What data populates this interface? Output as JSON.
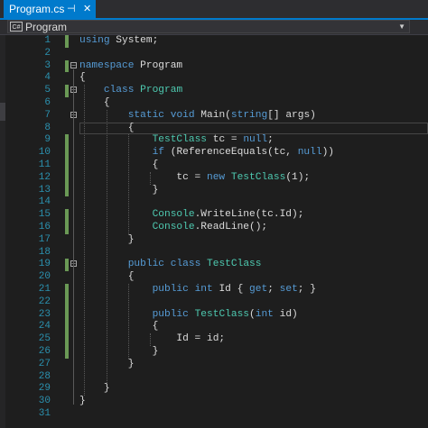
{
  "tab": {
    "title": "Program.cs",
    "pin_glyph": "⊣",
    "close_glyph": "✕"
  },
  "navbar": {
    "icon_text": "C#",
    "label": "Program"
  },
  "code_lines": [
    {
      "n": "1",
      "parts": [
        {
          "t": "using",
          "c": "kw"
        },
        {
          "t": " System;"
        }
      ]
    },
    {
      "n": "2",
      "parts": []
    },
    {
      "n": "3",
      "parts": [
        {
          "t": "namespace",
          "c": "kw"
        },
        {
          "t": " Program"
        }
      ]
    },
    {
      "n": "4",
      "parts": [
        {
          "t": "{"
        }
      ]
    },
    {
      "n": "5",
      "parts": [
        {
          "t": "    "
        },
        {
          "t": "class",
          "c": "kw"
        },
        {
          "t": " "
        },
        {
          "t": "Program",
          "c": "ty"
        }
      ]
    },
    {
      "n": "6",
      "parts": [
        {
          "t": "    {"
        }
      ]
    },
    {
      "n": "7",
      "parts": [
        {
          "t": "        "
        },
        {
          "t": "static",
          "c": "kw"
        },
        {
          "t": " "
        },
        {
          "t": "void",
          "c": "kw"
        },
        {
          "t": " Main("
        },
        {
          "t": "string",
          "c": "kw"
        },
        {
          "t": "[] args)"
        }
      ]
    },
    {
      "n": "8",
      "parts": [
        {
          "t": "        {"
        }
      ]
    },
    {
      "n": "9",
      "parts": [
        {
          "t": "            "
        },
        {
          "t": "TestClass",
          "c": "ty"
        },
        {
          "t": " tc = "
        },
        {
          "t": "null",
          "c": "kw"
        },
        {
          "t": ";"
        }
      ]
    },
    {
      "n": "10",
      "parts": [
        {
          "t": "            "
        },
        {
          "t": "if",
          "c": "kw"
        },
        {
          "t": " (ReferenceEquals(tc, "
        },
        {
          "t": "null",
          "c": "kw"
        },
        {
          "t": "))"
        }
      ]
    },
    {
      "n": "11",
      "parts": [
        {
          "t": "            {"
        }
      ]
    },
    {
      "n": "12",
      "parts": [
        {
          "t": "                tc = "
        },
        {
          "t": "new",
          "c": "kw"
        },
        {
          "t": " "
        },
        {
          "t": "TestClass",
          "c": "ty"
        },
        {
          "t": "(1);"
        }
      ]
    },
    {
      "n": "13",
      "parts": [
        {
          "t": "            }"
        }
      ]
    },
    {
      "n": "14",
      "parts": []
    },
    {
      "n": "15",
      "parts": [
        {
          "t": "            "
        },
        {
          "t": "Console",
          "c": "ty"
        },
        {
          "t": ".WriteLine(tc.Id);"
        }
      ]
    },
    {
      "n": "16",
      "parts": [
        {
          "t": "            "
        },
        {
          "t": "Console",
          "c": "ty"
        },
        {
          "t": ".ReadLine();"
        }
      ]
    },
    {
      "n": "17",
      "parts": [
        {
          "t": "        }"
        }
      ]
    },
    {
      "n": "18",
      "parts": []
    },
    {
      "n": "19",
      "parts": [
        {
          "t": "        "
        },
        {
          "t": "public",
          "c": "kw"
        },
        {
          "t": " "
        },
        {
          "t": "class",
          "c": "kw"
        },
        {
          "t": " "
        },
        {
          "t": "TestClass",
          "c": "ty"
        }
      ]
    },
    {
      "n": "20",
      "parts": [
        {
          "t": "        {"
        }
      ]
    },
    {
      "n": "21",
      "parts": [
        {
          "t": "            "
        },
        {
          "t": "public",
          "c": "kw"
        },
        {
          "t": " "
        },
        {
          "t": "int",
          "c": "kw"
        },
        {
          "t": " Id { "
        },
        {
          "t": "get",
          "c": "kw"
        },
        {
          "t": "; "
        },
        {
          "t": "set",
          "c": "kw"
        },
        {
          "t": "; }"
        }
      ]
    },
    {
      "n": "22",
      "parts": []
    },
    {
      "n": "23",
      "parts": [
        {
          "t": "            "
        },
        {
          "t": "public",
          "c": "kw"
        },
        {
          "t": " "
        },
        {
          "t": "TestClass",
          "c": "ty"
        },
        {
          "t": "("
        },
        {
          "t": "int",
          "c": "kw"
        },
        {
          "t": " id)"
        }
      ]
    },
    {
      "n": "24",
      "parts": [
        {
          "t": "            {"
        }
      ]
    },
    {
      "n": "25",
      "parts": [
        {
          "t": "                Id = id;"
        }
      ]
    },
    {
      "n": "26",
      "parts": [
        {
          "t": "            }"
        }
      ]
    },
    {
      "n": "27",
      "parts": [
        {
          "t": "        }"
        }
      ]
    },
    {
      "n": "28",
      "parts": []
    },
    {
      "n": "29",
      "parts": [
        {
          "t": "    }"
        }
      ]
    },
    {
      "n": "30",
      "parts": [
        {
          "t": "}"
        }
      ]
    },
    {
      "n": "31",
      "parts": []
    }
  ],
  "colors": {
    "keyword": "#569cd6",
    "type": "#4ec9b0",
    "text": "#dcdcdc",
    "line_number": "#2b91af",
    "change_mark": "#6a9955",
    "accent": "#007acc"
  },
  "icons": {
    "tab_pin": "pin-icon",
    "tab_close": "close-icon",
    "nav_class": "csharp-file-icon",
    "nav_dropdown": "chevron-down-icon",
    "fold": "collapse-icon"
  }
}
